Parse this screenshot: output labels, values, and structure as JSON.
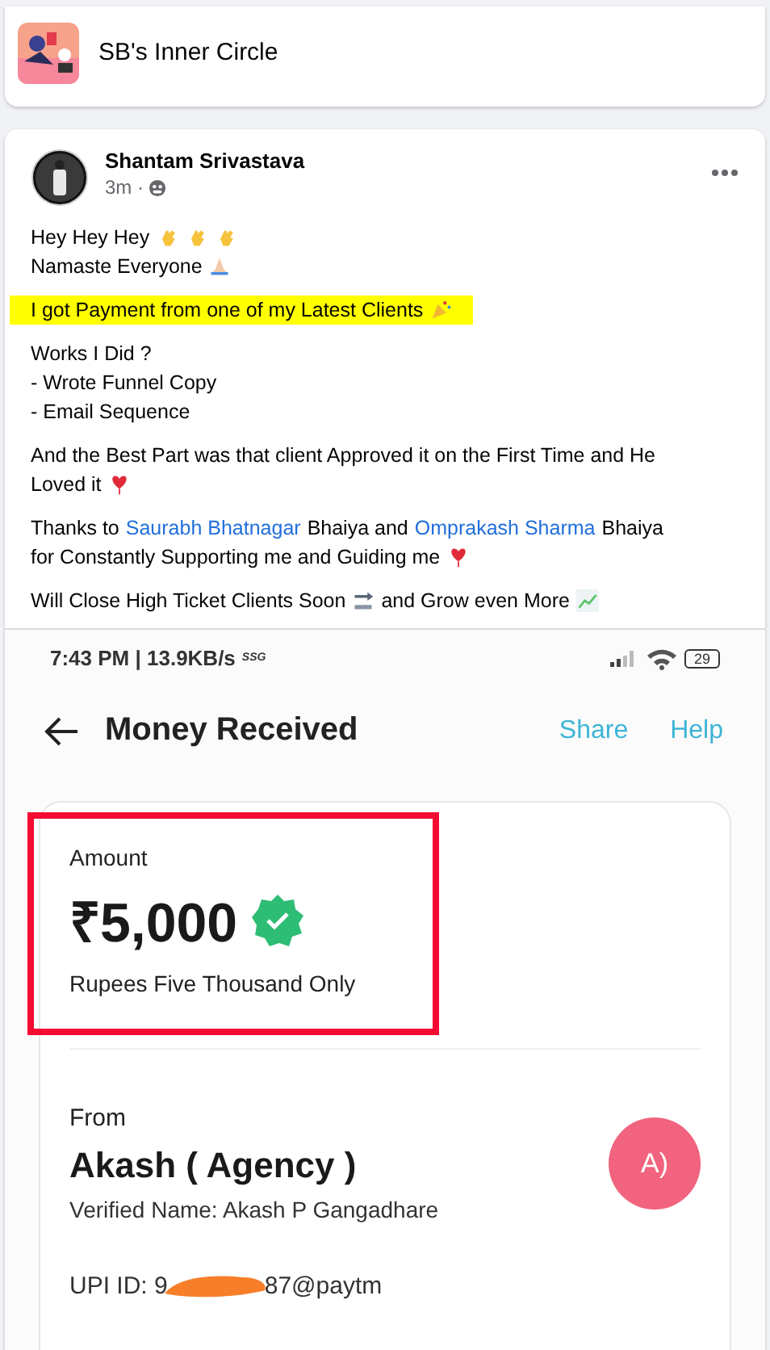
{
  "group": {
    "title": "SB's Inner Circle"
  },
  "post": {
    "author": "Shantam Srivastava",
    "time": "3m ·",
    "paragraphs": [
      {
        "highlighted": false,
        "lines": [
          [
            {
              "kind": "text",
              "text": "Hey Hey Hey"
            },
            {
              "kind": "wave"
            },
            {
              "kind": "wave"
            },
            {
              "kind": "wave"
            }
          ],
          [
            {
              "kind": "text",
              "text": "Namaste Everyone"
            },
            {
              "kind": "pray"
            }
          ]
        ]
      },
      {
        "highlighted": true,
        "lines": [
          [
            {
              "kind": "text",
              "text": "I got Payment from one of my Latest Clients"
            },
            {
              "kind": "party"
            }
          ]
        ]
      },
      {
        "highlighted": false,
        "lines": [
          [
            {
              "kind": "text",
              "text": "Works I Did ?"
            }
          ],
          [
            {
              "kind": "text",
              "text": "- Wrote Funnel Copy"
            }
          ],
          [
            {
              "kind": "text",
              "text": "- Email Sequence"
            }
          ]
        ]
      },
      {
        "highlighted": false,
        "lines": [
          [
            {
              "kind": "text",
              "text": "And the Best Part was that client Approved it on the First Time and He"
            }
          ],
          [
            {
              "kind": "text",
              "text": "Loved it"
            },
            {
              "kind": "heart"
            }
          ]
        ]
      },
      {
        "highlighted": false,
        "lines": [
          [
            {
              "kind": "text",
              "text": "Thanks to"
            },
            {
              "kind": "link",
              "text": "Saurabh Bhatnagar"
            },
            {
              "kind": "text",
              "text": " Bhaiya and"
            },
            {
              "kind": "link",
              "text": "Omprakash Sharma"
            },
            {
              "kind": "text",
              "text": " Bhaiya"
            }
          ],
          [
            {
              "kind": "text",
              "text": "for Constantly Supporting me and Guiding me"
            },
            {
              "kind": "heart"
            }
          ]
        ]
      },
      {
        "highlighted": false,
        "lines": [
          [
            {
              "kind": "text",
              "text": "Will Close High Ticket Clients Soon"
            },
            {
              "kind": "soon"
            },
            {
              "kind": "text",
              "text": "and Grow even More"
            },
            {
              "kind": "chart"
            }
          ]
        ]
      }
    ]
  },
  "phone": {
    "status": {
      "time": "7:43 PM | 13.9KB/s",
      "network": "SSG",
      "battery": "29"
    },
    "header": {
      "title": "Money Received",
      "actions": [
        "Share",
        "Help"
      ]
    },
    "amount": {
      "label": "Amount",
      "value": "₹5,000",
      "words": "Rupees Five Thousand Only",
      "verified": true
    },
    "sender": {
      "label": "From",
      "name": "Akash ( Agency )",
      "verified_name": "Verified Name: Akash P Gangadhare",
      "avatar": "A)",
      "upi_start": "UPI ID: 9",
      "upi_end": "87@paytm"
    }
  }
}
